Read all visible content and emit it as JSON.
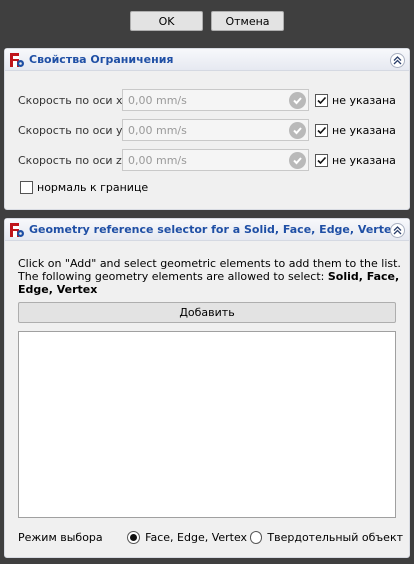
{
  "dialog": {
    "ok_label": "OK",
    "cancel_label": "Отмена"
  },
  "constraint_panel": {
    "title": "Свойства Ограничения",
    "rows": [
      {
        "label": "Скорость по оси x:",
        "value": "0,00 mm/s",
        "checkbox_label": "не указана",
        "checked": true
      },
      {
        "label": "Скорость по оси y:",
        "value": "0,00 mm/s",
        "checkbox_label": "не указана",
        "checked": true
      },
      {
        "label": "Скорость по оси z:",
        "value": "0,00 mm/s",
        "checkbox_label": "не указана",
        "checked": true
      }
    ],
    "normal_checkbox_label": "нормаль к границе",
    "normal_checked": false
  },
  "selector_panel": {
    "title": "Geometry reference selector for a Solid, Face, Edge, Vertex",
    "instruction_line1": "Click on \"Add\" and select geometric elements to add them to the list.",
    "instruction_line2_prefix": "The following geometry elements are allowed to select: ",
    "instruction_allowed": "Solid, Face, Edge, Vertex",
    "add_button_label": "Добавить",
    "list_items": [],
    "mode_label": "Режим выбора",
    "mode_options": [
      {
        "label": "Face, Edge, Vertex",
        "selected": true
      },
      {
        "label": "Твердотельный объект",
        "selected": false
      }
    ]
  },
  "colors": {
    "title_blue": "#1f4fa5",
    "background": "#3f3f3f",
    "panel": "#f0f0f0"
  }
}
